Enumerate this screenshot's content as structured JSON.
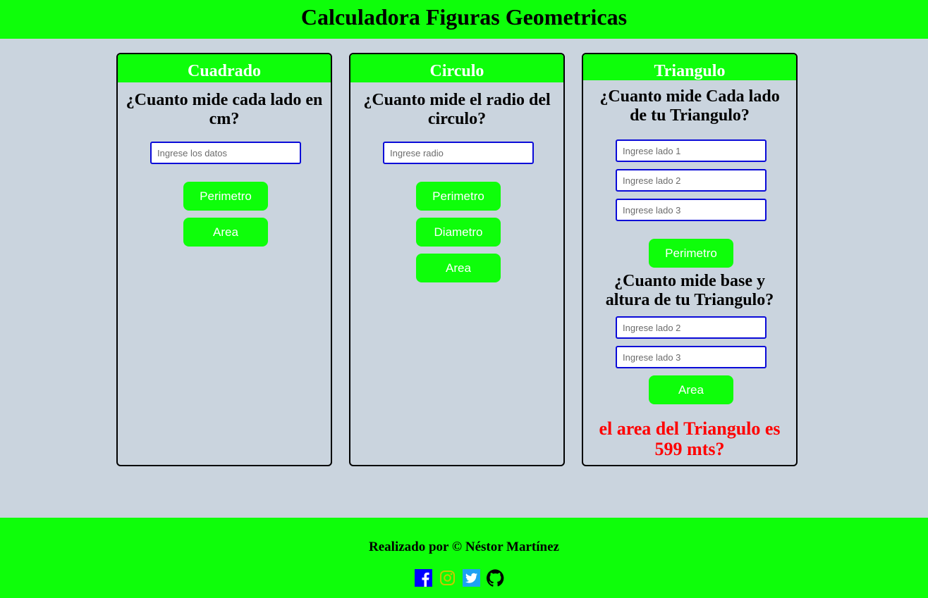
{
  "header": {
    "title": "Calculadora Figuras Geometricas"
  },
  "cuadrado": {
    "title": "Cuadrado",
    "question": "¿Cuanto mide cada lado en cm?",
    "input_placeholder": "Ingrese los datos",
    "buttons": {
      "perimetro": "Perimetro",
      "area": "Area"
    }
  },
  "circulo": {
    "title": "Circulo",
    "question": "¿Cuanto mide el radio del circulo?",
    "input_placeholder": "Ingrese radio",
    "buttons": {
      "perimetro": "Perimetro",
      "diametro": "Diametro",
      "area": "Area"
    }
  },
  "triangulo": {
    "title": "Triangulo",
    "question_lados": "¿Cuanto mide Cada lado de tu Triangulo?",
    "lado1_placeholder": "Ingrese lado 1",
    "lado2_placeholder": "Ingrese lado 2",
    "lado3_placeholder": "Ingrese lado 3",
    "perimetro_button": "Perimetro",
    "question_base_altura": "¿Cuanto mide base y altura de tu Triangulo?",
    "base_placeholder": "Ingrese lado 2",
    "altura_placeholder": "Ingrese lado 3",
    "area_button": "Area",
    "result": "el area del Triangulo es 599 mts?"
  },
  "footer": {
    "credit": "Realizado por © Néstor Martínez",
    "social_icons": [
      "facebook-icon",
      "instagram-icon",
      "twitter-icon",
      "github-icon"
    ]
  },
  "colors": {
    "accent_green": "#0efe0a",
    "background": "#cad4de",
    "input_border": "#0a0ad8",
    "result_red": "#ff0000",
    "facebook_blue": "#0000ff",
    "twitter_blue": "#1da1f2",
    "instagram_yellow": "#c8c800"
  }
}
